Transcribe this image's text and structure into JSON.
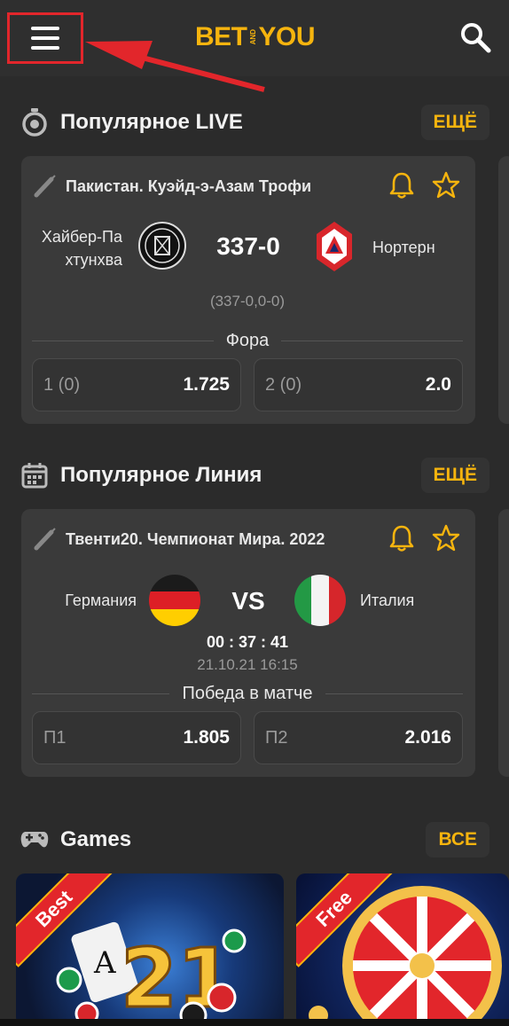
{
  "header": {
    "logo_left": "BET",
    "logo_mid": "AND",
    "logo_right": "YOU"
  },
  "live": {
    "title": "Популярное LIVE",
    "more": "ЕЩЁ",
    "league": "Пакистан. Куэйд-э-Азам Трофи",
    "home_line1": "Хайбер-Па",
    "home_line2": "хтунхва",
    "score": "337-0",
    "away": "Нортерн",
    "detail": "(337-0,0-0)",
    "market": "Фора",
    "odd1_label": "1 (0)",
    "odd1_value": "1.725",
    "odd2_label": "2 (0)",
    "odd2_value": "2.0"
  },
  "line": {
    "title": "Популярное Линия",
    "more": "ЕЩЁ",
    "league": "Твенти20. Чемпионат Мира. 2022",
    "home": "Германия",
    "vs": "VS",
    "away": "Италия",
    "countdown": "00 : 37 : 41",
    "datetime": "21.10.21 16:15",
    "market": "Победа в матче",
    "odd1_label": "П1",
    "odd1_value": "1.805",
    "odd2_label": "П2",
    "odd2_value": "2.016"
  },
  "games": {
    "title": "Games",
    "more": "ВСЕ",
    "tile1_ribbon": "Best",
    "tile2_ribbon": "Free"
  },
  "colors": {
    "accent": "#f6b40e",
    "background": "#2b2b2b",
    "card": "#3a3a3a",
    "highlight": "#e2262b"
  },
  "icons": [
    "menu-icon",
    "search-icon",
    "stopwatch-icon",
    "calendar-icon",
    "gamepad-icon",
    "cricket-bat-icon",
    "bell-icon",
    "star-icon"
  ]
}
